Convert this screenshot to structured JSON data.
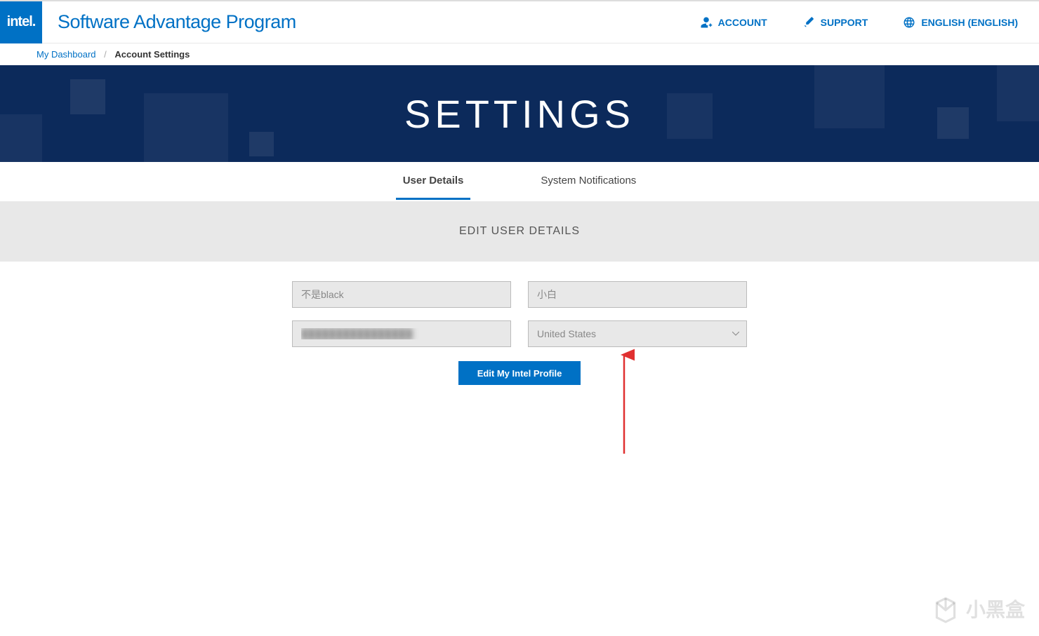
{
  "header": {
    "logo_text": "intel.",
    "brand": "Software Advantage Program",
    "nav": {
      "account": "ACCOUNT",
      "support": "SUPPORT",
      "language": "ENGLISH (ENGLISH)"
    }
  },
  "breadcrumb": {
    "home": "My Dashboard",
    "current": "Account Settings"
  },
  "banner": {
    "title": "SETTINGS"
  },
  "tabs": {
    "user_details": "User Details",
    "system_notifications": "System Notifications"
  },
  "section": {
    "edit_user_details": "EDIT USER DETAILS"
  },
  "form": {
    "first_name": "不是black",
    "last_name": "小白",
    "email": "████████████████",
    "country_selected": "United States",
    "button": "Edit My Intel Profile"
  },
  "watermark": {
    "text": "小黑盒"
  }
}
